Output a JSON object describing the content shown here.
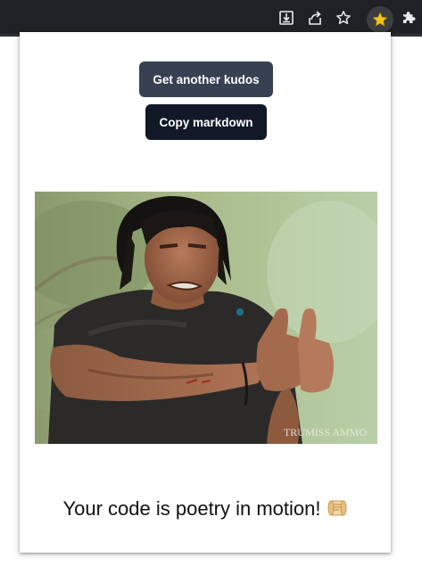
{
  "browser": {
    "toolbar_icons": [
      "download-icon",
      "share-icon",
      "bookmark-star-icon",
      "extension-kudos-icon",
      "extensions-puzzle-icon"
    ],
    "colors": {
      "toolbar": "#202124",
      "extension_star": "#f5c518"
    }
  },
  "popup": {
    "get_another_label": "Get another kudos",
    "copy_markdown_label": "Copy markdown",
    "image": {
      "description_icon": "thumbs-up-photo",
      "watermark": "TRUMISS AMMO"
    },
    "message": "Your code is poetry in motion!",
    "message_emoji": "📜",
    "colors": {
      "get_another_button": "#374151",
      "copy_button": "#111827"
    }
  }
}
